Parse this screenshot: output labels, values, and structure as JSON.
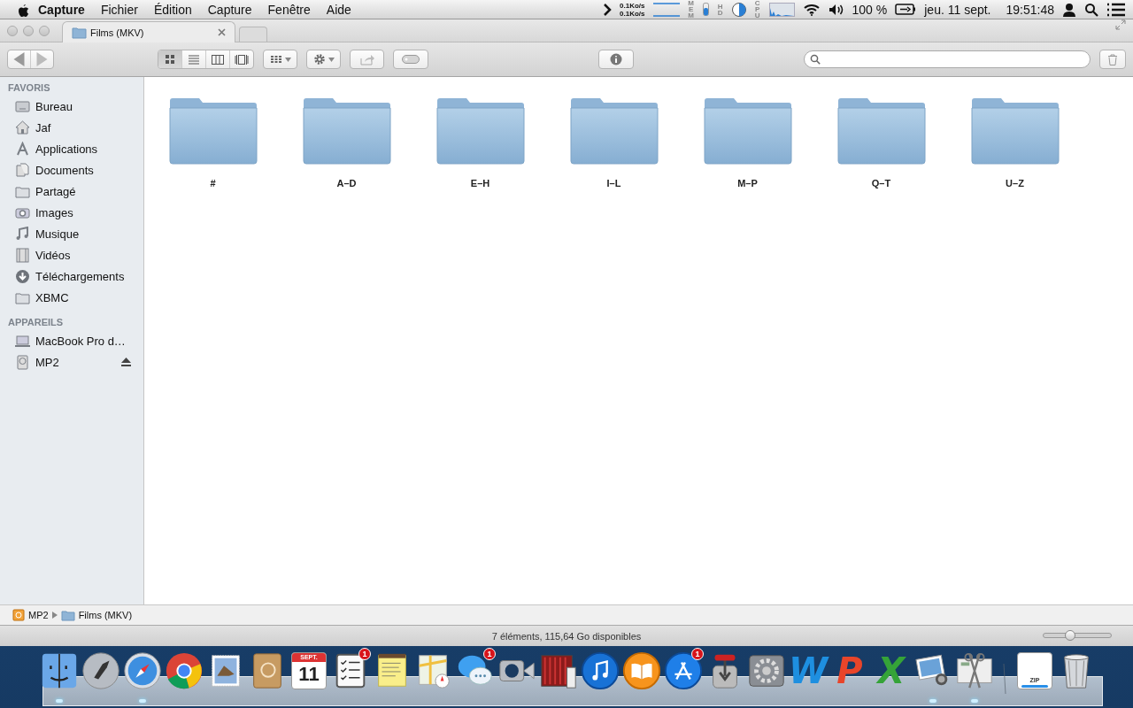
{
  "menu_bar": {
    "app_name": "Capture",
    "menus": [
      "Fichier",
      "Édition",
      "Capture",
      "Fenêtre",
      "Aide"
    ],
    "net_up": "0.1Ko/s",
    "net_down": "0.1Ko/s",
    "mem_label": "MEM",
    "hd_label": "HD",
    "cpu_label": "CPU",
    "battery": "100 %",
    "date": "jeu. 11 sept.",
    "time": "19:51:48"
  },
  "window": {
    "tabs": [
      {
        "title": "Films (MKV)",
        "selected": true
      }
    ],
    "toolbar": {
      "views": [
        {
          "kind": "icons",
          "selected": true
        },
        {
          "kind": "list",
          "selected": false
        },
        {
          "kind": "columns",
          "selected": false
        },
        {
          "kind": "coverflow",
          "selected": false
        }
      ]
    },
    "sidebar": {
      "sections": [
        {
          "heading": "FAVORIS",
          "items": [
            {
              "label": "Bureau",
              "kind": "desktop",
              "ejectable": false
            },
            {
              "label": "Jaf",
              "kind": "home",
              "ejectable": false
            },
            {
              "label": "Applications",
              "kind": "apps",
              "ejectable": false
            },
            {
              "label": "Documents",
              "kind": "docs",
              "ejectable": false
            },
            {
              "label": "Partagé",
              "kind": "folder",
              "ejectable": false
            },
            {
              "label": "Images",
              "kind": "camera",
              "ejectable": false
            },
            {
              "label": "Musique",
              "kind": "music",
              "ejectable": false
            },
            {
              "label": "Vidéos",
              "kind": "movies",
              "ejectable": false
            },
            {
              "label": "Téléchargements",
              "kind": "download",
              "ejectable": false
            },
            {
              "label": "XBMC",
              "kind": "folder",
              "ejectable": false
            }
          ]
        },
        {
          "heading": "APPAREILS",
          "items": [
            {
              "label": "MacBook Pro d…",
              "kind": "laptop",
              "ejectable": false
            },
            {
              "label": "MP2",
              "kind": "drive",
              "ejectable": true
            }
          ]
        }
      ]
    },
    "folders": [
      "#",
      "A–D",
      "E–H",
      "I–L",
      "M–P",
      "Q–T",
      "U–Z"
    ],
    "path_bar": [
      {
        "label": "MP2",
        "kind": "drive"
      },
      {
        "label": "Films (MKV)",
        "kind": "folder"
      }
    ],
    "status_bar": {
      "text": "7 éléments, 115,64 Go disponibles",
      "slider": {
        "level": 0.39
      }
    }
  },
  "dock": {
    "items": [
      {
        "kind": "finder",
        "running": true
      },
      {
        "kind": "launchpad",
        "running": false
      },
      {
        "kind": "safari",
        "running": true
      },
      {
        "kind": "chrome",
        "running": false
      },
      {
        "kind": "mail",
        "running": false
      },
      {
        "kind": "contacts",
        "running": false
      },
      {
        "kind": "calendar",
        "running": false,
        "month": "SEPT.",
        "day": "11"
      },
      {
        "kind": "reminders",
        "running": false,
        "badge": "1"
      },
      {
        "kind": "notes",
        "running": false
      },
      {
        "kind": "maps",
        "running": false
      },
      {
        "kind": "messages",
        "running": false,
        "badge": "1"
      },
      {
        "kind": "facetime",
        "running": false
      },
      {
        "kind": "photobooth",
        "running": false
      },
      {
        "kind": "itunes",
        "running": false
      },
      {
        "kind": "ibooks",
        "running": false
      },
      {
        "kind": "appstore",
        "running": false,
        "badge": "1"
      },
      {
        "kind": "transmission",
        "running": false
      },
      {
        "kind": "preferences",
        "running": false
      },
      {
        "kind": "letter",
        "running": false,
        "glyph": "W",
        "color": "#1e8fe0"
      },
      {
        "kind": "letter",
        "running": false,
        "glyph": "P",
        "color": "#e8452a"
      },
      {
        "kind": "letter",
        "running": false,
        "glyph": "X",
        "color": "#35a338"
      },
      {
        "kind": "preview",
        "running": true
      },
      {
        "kind": "capture",
        "running": true
      },
      {
        "kind": "separator"
      },
      {
        "kind": "zip",
        "running": false,
        "label": "ZIP"
      },
      {
        "kind": "trash",
        "running": false
      }
    ]
  }
}
